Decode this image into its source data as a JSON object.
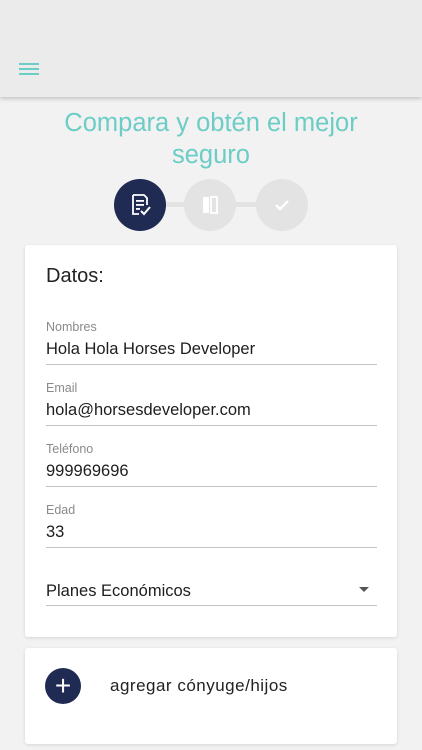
{
  "header": {
    "menu_icon": "hamburger-menu-icon"
  },
  "title": "Compara y obtén el mejor seguro",
  "stepper": {
    "steps": [
      {
        "icon": "form-checklist-icon",
        "state": "active"
      },
      {
        "icon": "compare-split-icon",
        "state": "inactive"
      },
      {
        "icon": "checkmark-icon",
        "state": "inactive"
      }
    ],
    "active_color": "#1f2b52",
    "inactive_color": "#e3e3e3"
  },
  "form": {
    "title": "Datos:",
    "fields": [
      {
        "label": "Nombres",
        "value": "Hola Hola Horses Developer"
      },
      {
        "label": "Email",
        "value": "hola@horsesdeveloper.com"
      },
      {
        "label": "Teléfono",
        "value": "999969696"
      },
      {
        "label": "Edad",
        "value": "33"
      }
    ],
    "plan_select": {
      "value": "Planes Económicos"
    }
  },
  "add_dependents": {
    "icon": "plus-icon",
    "label": "agregar cónyuge/hijos"
  },
  "colors": {
    "accent": "#6ccdc6",
    "primary": "#1f2b52",
    "background": "#f2f2f2"
  }
}
